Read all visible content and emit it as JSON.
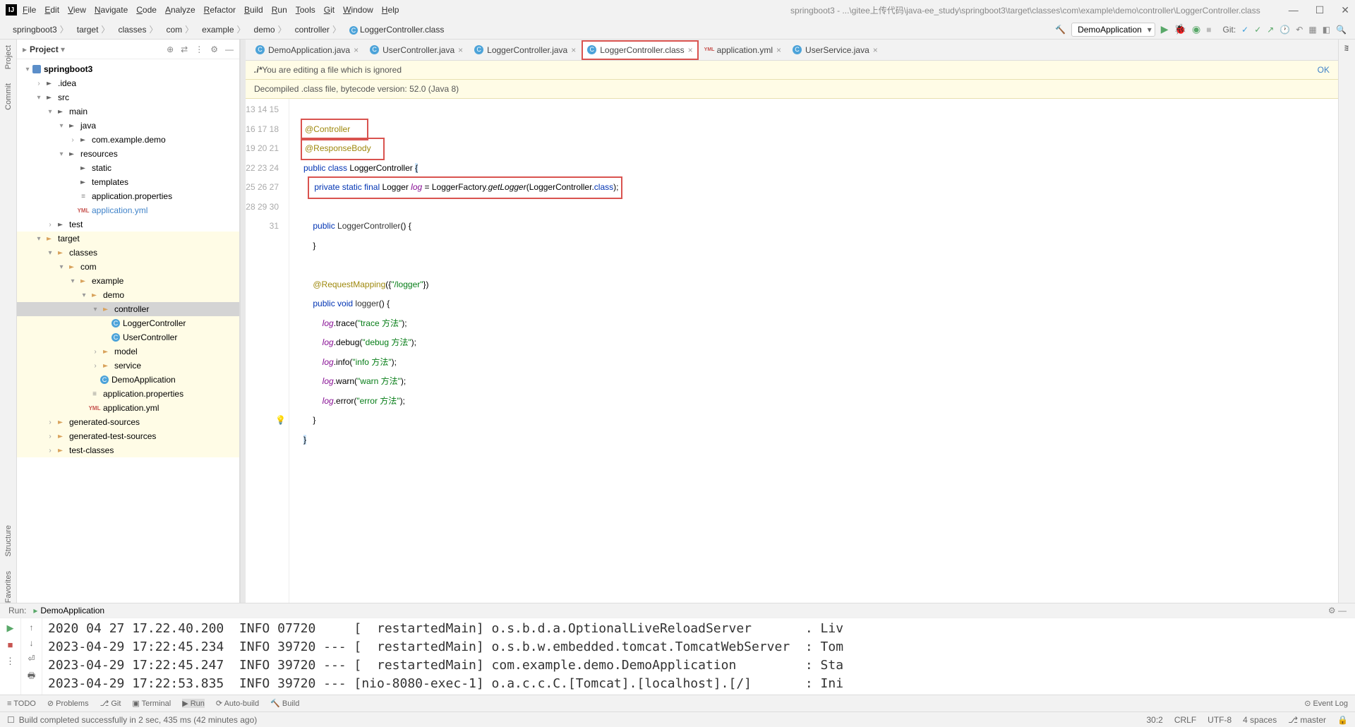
{
  "menu": [
    "File",
    "Edit",
    "View",
    "Navigate",
    "Code",
    "Analyze",
    "Refactor",
    "Build",
    "Run",
    "Tools",
    "Git",
    "Window",
    "Help"
  ],
  "titlePath": "springboot3 - ...\\gitee上传代码\\java-ee_study\\springboot3\\target\\classes\\com\\example\\demo\\controller\\LoggerController.class",
  "breadcrumb": [
    "springboot3",
    "target",
    "classes",
    "com",
    "example",
    "demo",
    "controller",
    "LoggerController.class"
  ],
  "runConfig": "DemoApplication",
  "gitLabel": "Git:",
  "projectTool": "Project",
  "leftRails": [
    "Project",
    "Commit"
  ],
  "leftBotRails": [
    "Structure",
    "Favorites"
  ],
  "rightRail": "m\naven",
  "tabs": [
    {
      "label": "DemoApplication.java",
      "icon": "C"
    },
    {
      "label": "UserController.java",
      "icon": "C"
    },
    {
      "label": "LoggerController.java",
      "icon": "C"
    },
    {
      "label": "LoggerController.class",
      "icon": "C",
      "boxed": true,
      "active": true
    },
    {
      "label": "application.yml",
      "icon": "YML"
    },
    {
      "label": "UserService.java",
      "icon": "C"
    }
  ],
  "banner1_pre": ".i* ",
  "banner1": "You are editing a file which is ignored",
  "banner1_ok": "OK",
  "banner2": "Decompiled .class file, bytecode version: 52.0 (Java 8)",
  "tree": [
    {
      "d": 0,
      "ar": "▾",
      "ic": "mod",
      "t": "springboot3",
      "b": true
    },
    {
      "d": 1,
      "ar": "›",
      "ic": "dir",
      "t": ".idea"
    },
    {
      "d": 1,
      "ar": "▾",
      "ic": "dir",
      "t": "src"
    },
    {
      "d": 2,
      "ar": "▾",
      "ic": "dir",
      "t": "main"
    },
    {
      "d": 3,
      "ar": "▾",
      "ic": "dir",
      "t": "java",
      "blue": true
    },
    {
      "d": 4,
      "ar": "›",
      "ic": "dir",
      "t": "com.example.demo"
    },
    {
      "d": 3,
      "ar": "▾",
      "ic": "dir",
      "t": "resources"
    },
    {
      "d": 4,
      "ar": "",
      "ic": "dir",
      "t": "static"
    },
    {
      "d": 4,
      "ar": "",
      "ic": "dir",
      "t": "templates"
    },
    {
      "d": 4,
      "ar": "",
      "ic": "prop",
      "t": "application.properties"
    },
    {
      "d": 4,
      "ar": "",
      "ic": "yml",
      "t": "application.yml",
      "link": true
    },
    {
      "d": 2,
      "ar": "›",
      "ic": "dir",
      "t": "test"
    },
    {
      "d": 1,
      "ar": "▾",
      "ic": "diro",
      "t": "target",
      "hi": true
    },
    {
      "d": 2,
      "ar": "▾",
      "ic": "diro",
      "t": "classes",
      "hi": true
    },
    {
      "d": 3,
      "ar": "▾",
      "ic": "diro",
      "t": "com",
      "hi": true
    },
    {
      "d": 4,
      "ar": "▾",
      "ic": "diro",
      "t": "example",
      "hi": true
    },
    {
      "d": 5,
      "ar": "▾",
      "ic": "diro",
      "t": "demo",
      "hi": true
    },
    {
      "d": 6,
      "ar": "▾",
      "ic": "diro",
      "t": "controller",
      "sel": true
    },
    {
      "d": 7,
      "ar": "",
      "ic": "cls",
      "t": "LoggerController",
      "hi": true
    },
    {
      "d": 7,
      "ar": "",
      "ic": "cls",
      "t": "UserController",
      "hi": true
    },
    {
      "d": 6,
      "ar": "›",
      "ic": "diro",
      "t": "model",
      "hi": true
    },
    {
      "d": 6,
      "ar": "›",
      "ic": "diro",
      "t": "service",
      "hi": true
    },
    {
      "d": 6,
      "ar": "",
      "ic": "cls",
      "t": "DemoApplication",
      "hi": true
    },
    {
      "d": 5,
      "ar": "",
      "ic": "prop",
      "t": "application.properties",
      "hi": true
    },
    {
      "d": 5,
      "ar": "",
      "ic": "yml",
      "t": "application.yml",
      "hi": true
    },
    {
      "d": 2,
      "ar": "›",
      "ic": "diro",
      "t": "generated-sources",
      "hi": true
    },
    {
      "d": 2,
      "ar": "›",
      "ic": "diro",
      "t": "generated-test-sources",
      "hi": true
    },
    {
      "d": 2,
      "ar": "›",
      "ic": "diro",
      "t": "test-classes",
      "hi": true
    }
  ],
  "lineStart": 13,
  "code": [
    "",
    "<span class='redbox'><span class='ann'>@Controller</span>      </span>",
    "<span class='redbox'><span class='ann'>@ResponseBody</span>    </span>",
    "<span class='kw'>public</span> <span class='kw'>class</span> LoggerController <span class='hl'>{</span>",
    "   <span class='redbox'> <span class='kw'>private</span> <span class='kw'>static</span> <span class='kw'>final</span> Logger <span class='fld'>log</span> = LoggerFactory.<span class='mtd'>getLogger</span>(LoggerController.<span class='kw'>class</span>);</span>",
    "",
    "    <span class='kw'>public</span> <span class='cls-n'>LoggerController</span>() {",
    "    }",
    "",
    "    <span class='ann'>@RequestMapping</span>({<span class='str'>\"/logger\"</span>})",
    "    <span class='kw'>public</span> <span class='kw'>void</span> <span class='cls-n'>logger</span>() {",
    "        <span class='fld'>log</span>.trace(<span class='str'>\"trace 方法\"</span>);",
    "        <span class='fld'>log</span>.debug(<span class='str'>\"debug 方法\"</span>);",
    "        <span class='fld'>log</span>.info(<span class='str'>\"info 方法\"</span>);",
    "        <span class='fld'>log</span>.warn(<span class='str'>\"warn 方法\"</span>);",
    "        <span class='fld'>log</span>.error(<span class='str'>\"error 方法\"</span>);",
    "    }",
    "<span class='hl'>}</span>",
    ""
  ],
  "runLabel": "Run:",
  "runName": "DemoApplication",
  "console": [
    "2023-04-29 17:22:45.234  INFO 39720 --- [  restartedMain] o.s.b.w.embedded.tomcat.TomcatWebServer  : Tom",
    "2023-04-29 17:22:45.247  INFO 39720 --- [  restartedMain] com.example.demo.DemoApplication         : Sta",
    "2023-04-29 17:22:53.835  INFO 39720 --- [nio-8080-exec-1] o.a.c.c.C.[Tomcat].[localhost].[/]       : Ini"
  ],
  "tools": [
    "≡ TODO",
    "⊘ Problems",
    "⎇ Git",
    "▣ Terminal",
    "▶ Run",
    "⟳ Auto-build",
    "🔨 Build"
  ],
  "eventLog": "⊙ Event Log",
  "statusMsg": "Build completed successfully in 2 sec, 435 ms (42 minutes ago)",
  "status": {
    "pos": "30:2",
    "le": "CRLF",
    "enc": "UTF-8",
    "ind": "4 spaces",
    "branch": "⎇ master"
  }
}
